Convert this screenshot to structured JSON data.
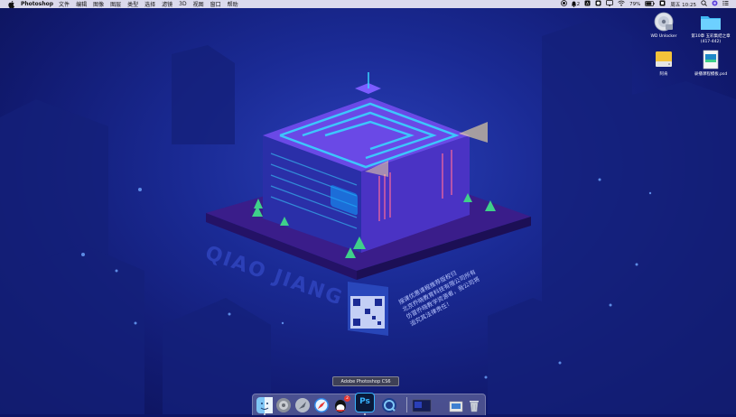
{
  "menubar": {
    "app_name": "Photoshop",
    "menus": [
      "文件",
      "编辑",
      "图像",
      "图层",
      "类型",
      "选择",
      "滤镜",
      "3D",
      "视图",
      "窗口",
      "帮助"
    ],
    "status": {
      "badge_count": "2",
      "battery": "79%",
      "datetime": "周五 10:25"
    }
  },
  "desktop": {
    "icons": [
      {
        "label": "WD Unlocker",
        "icon": "disc-icon"
      },
      {
        "label": "第10章 五彩集结之章 (417-442)",
        "icon": "folder-icon"
      },
      {
        "label": "阿肯",
        "icon": "drive-icon"
      },
      {
        "label": "录播课程模板.psd",
        "icon": "psd-file-icon"
      }
    ]
  },
  "wallpaper": {
    "watermark_title": "QIAO JIANG",
    "watermark_lines": [
      "搜课优惠课程推荐版权归",
      "北京乔晓教育科技有限公司所有",
      "仿冒乔晓教学资源者，我公司将",
      "追究其法律责任！"
    ]
  },
  "dock": {
    "tooltip": "Adobe Photoshop CS6",
    "qq_badge": "2",
    "ps_label": "Ps",
    "items": [
      "finder-icon",
      "system-prefs-icon",
      "launchpad-icon",
      "safari-icon",
      "qq-icon",
      "photoshop-icon",
      "quicktime-icon",
      "screen-preview-icon",
      "downloads-icon",
      "trash-icon"
    ]
  },
  "colors": {
    "menubar_bg": "#ebe8f5",
    "wallpaper_deep": "#0b1050",
    "wallpaper_mid": "#1a2a94",
    "neon_cyan": "#39d4ff",
    "building_purple": "#5a2fc8"
  }
}
